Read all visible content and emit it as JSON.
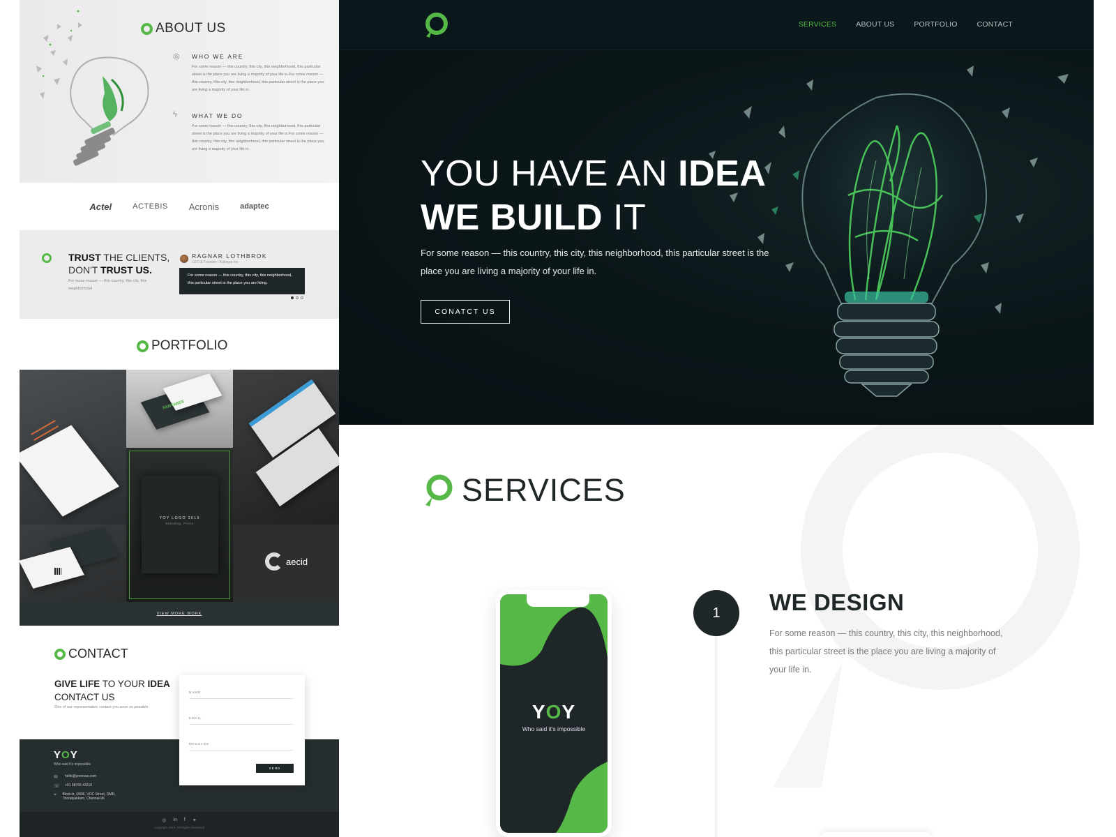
{
  "left_preview": {
    "about": {
      "title": "ABOUT US",
      "who_title": "WHO WE ARE",
      "who_text": "For some reason — this country, this city, this neighborhood, this particular street is the place you are living a majority of your life in.For some reason — this country, this city, this neighborhood, this particular street is the place you are living a majority of your life in.",
      "what_title": "WHAT WE DO",
      "what_text": "For some reason — this country, this city, this neighborhood, this particular street is the place you are living a majority of your life in.For some reason — this country, this city, this neighborhood, this particular street is the place you are living a majority of your life in."
    },
    "clients": [
      "Actel",
      "ACTEBIS",
      "Acronis",
      "adaptec"
    ],
    "trust": {
      "line1_bold": "TRUST",
      "line1_rest": " THE CLIENTS,",
      "line2_pre": "DON'T ",
      "line2_bold": "TRUST US.",
      "sub": "For some reason — this country, this city, this neighborhood",
      "testimonial_name": "RAGNAR LOTHBROK",
      "testimonial_role": "CEO & Founder / Kattegat Inc",
      "testimonial_text": "For some reason — this country, this city, this neighborhood, this particular street is the place you are living."
    },
    "portfolio": {
      "title": "PORTFOLIO",
      "featured_title": "YOY LOGO 2019",
      "featured_sub": "Branding, Prints",
      "aecid": "aecid",
      "fantabee": "FANTABEE",
      "view_more": "VIEW MORE WORK"
    },
    "contact": {
      "title": "CONTACT",
      "lead_bold1": "GIVE LIFE",
      "lead_mid": " TO YOUR ",
      "lead_bold2": "IDEA",
      "lead_line2": "CONTACT US",
      "note": "One of our representative contact you soon as possible.",
      "field_name": "NAME",
      "field_email": "EMAIL",
      "field_message": "MESSAGE",
      "send": "SEND"
    },
    "footer": {
      "logo_y1": "Y",
      "logo_o": "O",
      "logo_y2": "Y",
      "tagline": "Who said it's impossible",
      "email": "hello@yoonvas.com",
      "phone": "+91 98765 43210",
      "address": "Block-b, 4/606, VOC Street, OMR, Thoraipakkam, Chennai-96",
      "copyright": "Copyright 2019, All Rights Reserved"
    }
  },
  "nav": {
    "links": [
      "SERVICES",
      "ABOUT US",
      "PORTFOLIO",
      "CONTACT"
    ],
    "active": "SERVICES"
  },
  "hero": {
    "line1_light": "YOU HAVE AN ",
    "line1_bold": "IDEA",
    "line2_bold": "WE BUILD",
    "line2_light": " IT",
    "text": "For some reason — this country, this city, this neighborhood, this particular street is the place you are living a majority of your life in.",
    "button": "CONATCT US"
  },
  "services": {
    "title": "SERVICES",
    "step_number": "1",
    "step_title_light": "WE ",
    "step_title_bold": "DESIGN",
    "step_text": "For some reason — this country, this city, this neighborhood, this particular street is the place you are living a majority of your life in.",
    "phone_logo_y1": "Y",
    "phone_logo_o": "O",
    "phone_logo_y2": "Y",
    "phone_tagline": "Who said it's impossible"
  },
  "colors": {
    "accent_green": "#56b947",
    "dark": "#1f2628",
    "hero_bg": "#0b181b"
  }
}
